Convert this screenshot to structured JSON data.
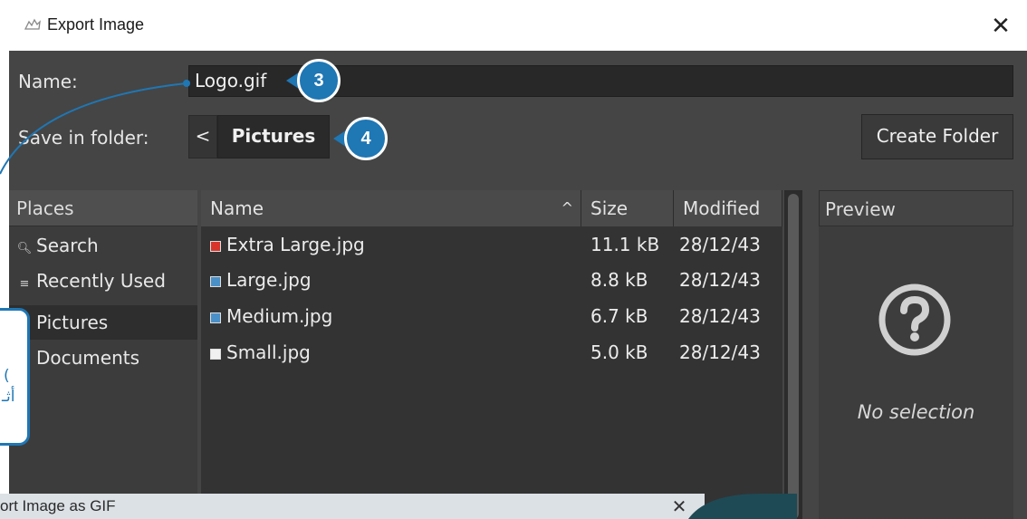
{
  "window": {
    "title": "Export Image",
    "close_glyph": "✕"
  },
  "form": {
    "name_label": "Name:",
    "name_value": "Logo.gif",
    "folder_label": "Save in folder:",
    "folder_back_glyph": "<",
    "folder_crumb": "Pictures",
    "create_folder_label": "Create Folder"
  },
  "places": {
    "header": "Places",
    "items": [
      {
        "label": "Search",
        "icon": "search-icon"
      },
      {
        "label": "Recently Used",
        "icon": "recent-icon"
      },
      {
        "label": "Pictures",
        "icon": "folder-icon",
        "selected": true
      },
      {
        "label": "Documents",
        "icon": "folder-icon"
      }
    ]
  },
  "files": {
    "headers": {
      "name": "Name",
      "size": "Size",
      "modified": "Modified",
      "sort_glyph": "^"
    },
    "rows": [
      {
        "name": "Extra Large.jpg",
        "size": "11.1 kB",
        "modified": "28/12/43",
        "icon_color": "#d9342b"
      },
      {
        "name": "Large.jpg",
        "size": "8.8 kB",
        "modified": "28/12/43",
        "icon_color": "#4a90c8"
      },
      {
        "name": "Medium.jpg",
        "size": "6.7 kB",
        "modified": "28/12/43",
        "icon_color": "#4a90c8"
      },
      {
        "name": "Small.jpg",
        "size": "5.0 kB",
        "modified": "28/12/43",
        "icon_color": "#f0f0f0"
      }
    ]
  },
  "preview": {
    "header": "Preview",
    "empty_text": "No selection"
  },
  "callouts": {
    "name_step": "3",
    "folder_step": "4",
    "side_text": "أثـ",
    "side_bar": "("
  },
  "sub_window": {
    "title": "ort Image as GIF",
    "close_glyph": "✕"
  },
  "colors": {
    "accent": "#1f77b4",
    "dialog_bg": "#454545"
  }
}
